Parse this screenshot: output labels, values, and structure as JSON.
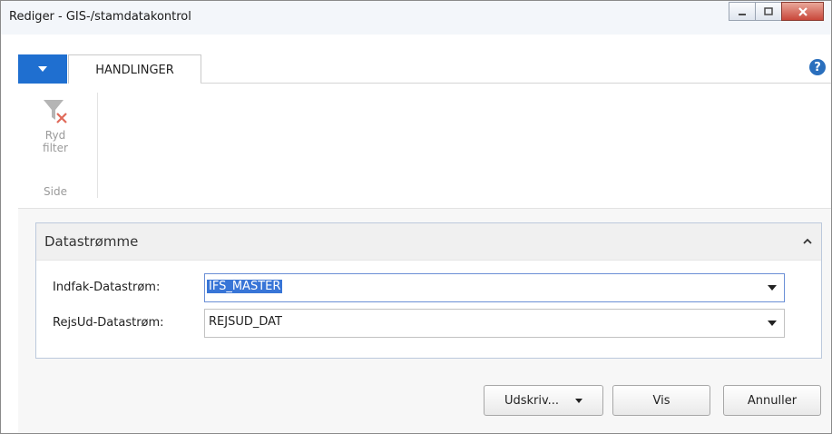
{
  "window": {
    "title": "Rediger - GIS-/stamdatakontrol"
  },
  "ribbon": {
    "active_tab": "HANDLINGER",
    "clear_filter_label_1": "Ryd",
    "clear_filter_label_2": "filter",
    "group_label": "Side",
    "help_glyph": "?"
  },
  "panel": {
    "title": "Datastrømme",
    "fields": [
      {
        "label": "Indfak-Datastrøm:",
        "value": "IFS_MASTER"
      },
      {
        "label": "RejsUd-Datastrøm:",
        "value": "REJSUD_DAT"
      }
    ]
  },
  "buttons": {
    "print": "Udskriv...",
    "show": "Vis",
    "cancel": "Annuller"
  },
  "colors": {
    "menu_tab": "#1f6fd0",
    "selection": "#3875d7",
    "panel_border": "#bcc9dc"
  }
}
